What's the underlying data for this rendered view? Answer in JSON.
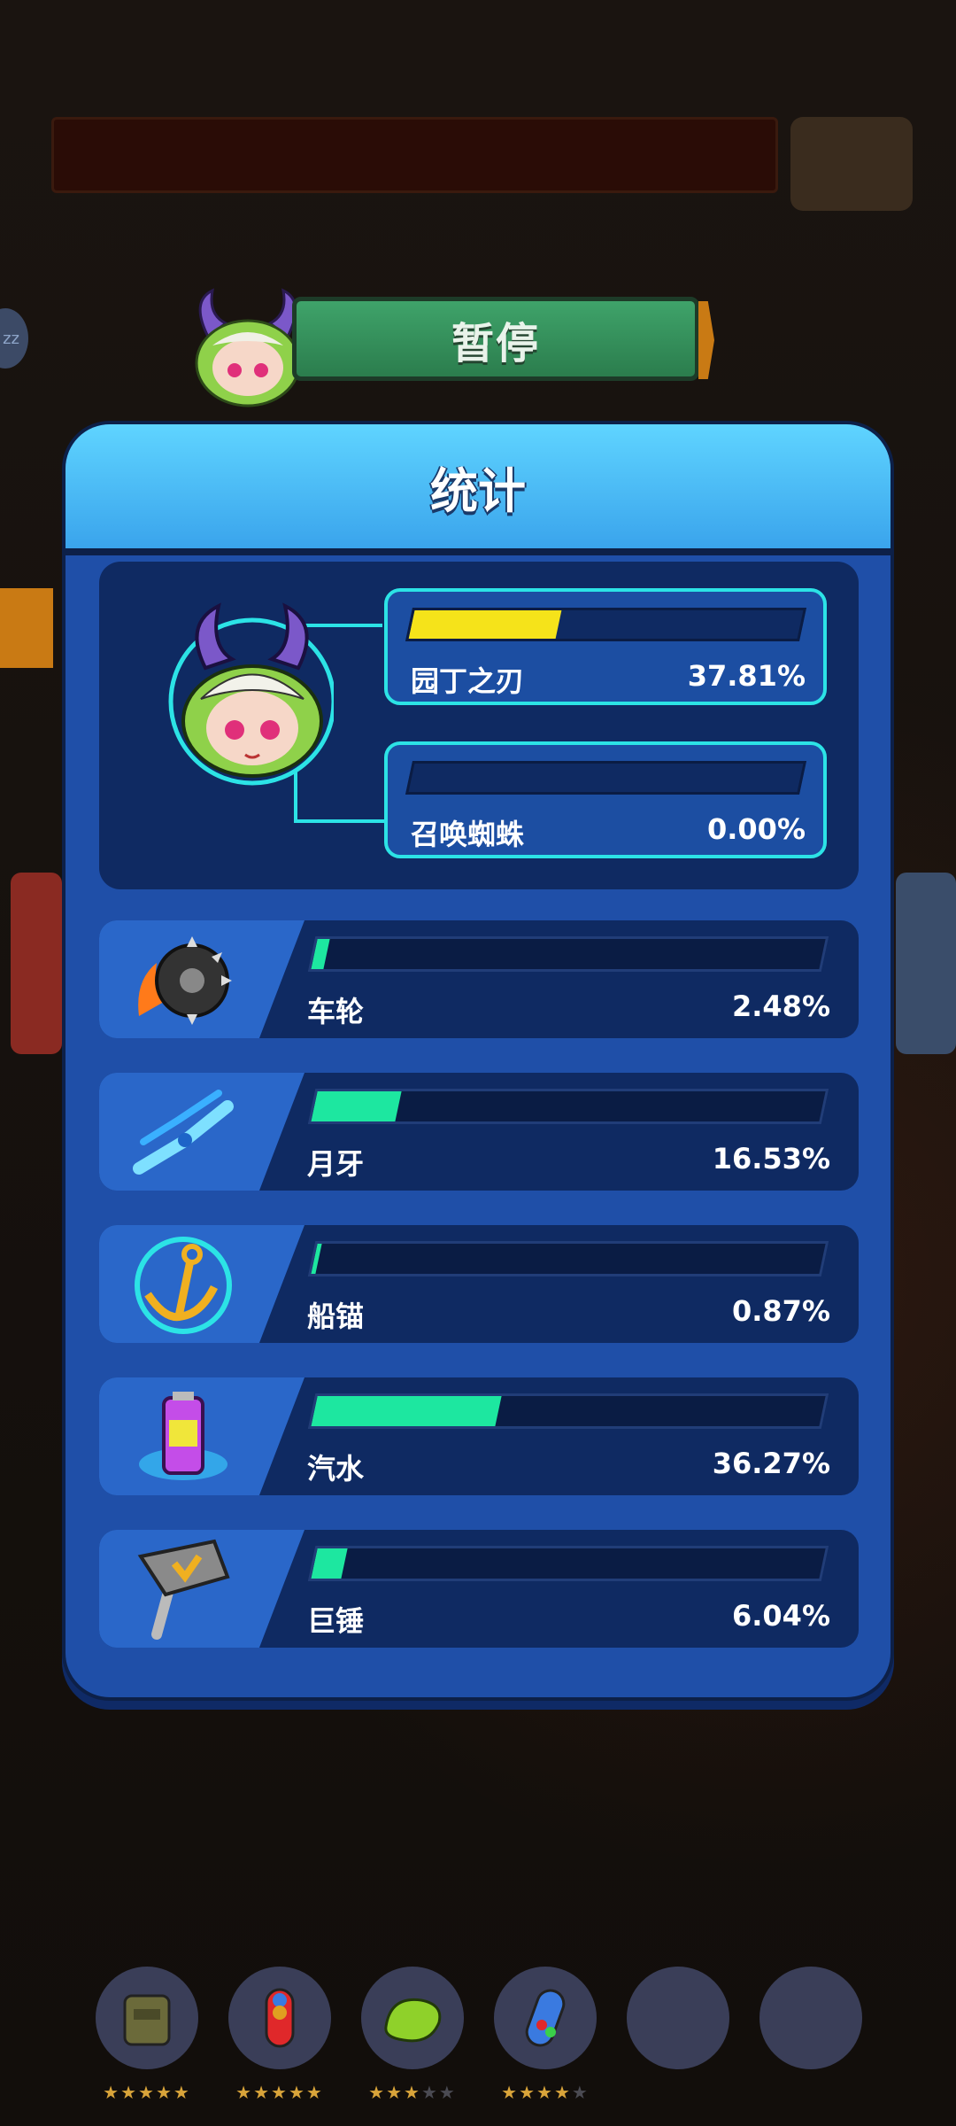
{
  "pause": {
    "label": "暂停"
  },
  "panel": {
    "title": "统计"
  },
  "hero": {
    "skills": [
      {
        "name": "园丁之刃",
        "percent": "37.81%",
        "fill": 0.378
      },
      {
        "name": "召唤蜘蛛",
        "percent": "0.00%",
        "fill": 0.0
      }
    ]
  },
  "weapons": [
    {
      "name": "车轮",
      "percent": "2.48%",
      "fill": 0.025,
      "icon": "spiked-wheel-icon"
    },
    {
      "name": "月牙",
      "percent": "16.53%",
      "fill": 0.165,
      "icon": "crescent-blade-icon"
    },
    {
      "name": "船锚",
      "percent": "0.87%",
      "fill": 0.009,
      "icon": "anchor-icon"
    },
    {
      "name": "汽水",
      "percent": "36.27%",
      "fill": 0.363,
      "icon": "soda-can-icon"
    },
    {
      "name": "巨锤",
      "percent": "6.04%",
      "fill": 0.06,
      "icon": "hammer-icon"
    }
  ],
  "items": [
    {
      "icon": "vest-icon",
      "stars": 5,
      "max": 5
    },
    {
      "icon": "capsule-icon",
      "stars": 5,
      "max": 5
    },
    {
      "icon": "bean-icon",
      "stars": 3,
      "max": 5
    },
    {
      "icon": "pill-icon",
      "stars": 4,
      "max": 5
    },
    {
      "icon": "empty-slot",
      "stars": 0,
      "max": 0
    },
    {
      "icon": "empty-slot",
      "stars": 0,
      "max": 0
    }
  ],
  "colors": {
    "accent_cyan": "#2ce3e6",
    "hero_bar": "#f5e31a",
    "weapon_bar": "#1de7a0",
    "panel_blue": "#1f4fa8"
  }
}
